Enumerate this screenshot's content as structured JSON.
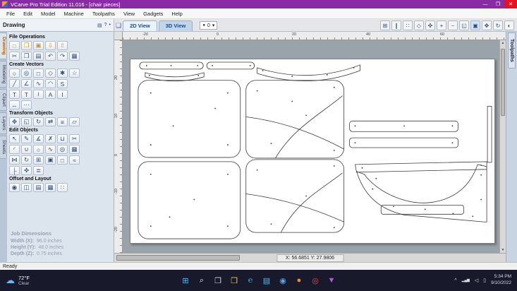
{
  "titlebar": {
    "title": "VCarve Pro Trial Edition 11.016 - [chair pieces]",
    "minimize": "—",
    "maximize": "❐",
    "close": "✕"
  },
  "menu": {
    "items": [
      {
        "label": "File"
      },
      {
        "label": "Edit"
      },
      {
        "label": "Model"
      },
      {
        "label": "Machine"
      },
      {
        "label": "Toolpaths"
      },
      {
        "label": "View"
      },
      {
        "label": "Gadgets"
      },
      {
        "label": "Help"
      }
    ]
  },
  "panel_header": {
    "title": "Drawing",
    "icons": [
      {
        "n": "panel-options-icon",
        "g": "▤"
      },
      {
        "n": "help-icon",
        "g": "?"
      },
      {
        "n": "pin-icon",
        "g": "•"
      }
    ]
  },
  "view_toolbar": {
    "window_icon": "❏",
    "tabs": [
      {
        "label": "2D View"
      },
      {
        "label": "3D View"
      }
    ],
    "layer": {
      "dot": "●",
      "value": "0",
      "caret": "▾"
    },
    "icons": [
      {
        "n": "toggle-grid-icon",
        "g": "⊞"
      },
      {
        "n": "toggle-guides-icon",
        "g": "∥"
      },
      {
        "n": "snap-grid-icon",
        "g": "∷"
      },
      {
        "n": "snap-geometry-icon",
        "g": "◇"
      },
      {
        "n": "snap-smart-icon",
        "g": "✜"
      },
      {
        "n": "zoom-in-icon",
        "g": "+"
      },
      {
        "n": "zoom-out-icon",
        "g": "−"
      },
      {
        "n": "zoom-window-icon",
        "g": "◱"
      },
      {
        "n": "zoom-extents-icon",
        "g": "▣",
        "bg": "#cfe4f8"
      },
      {
        "n": "pan-view-icon",
        "g": "✥"
      },
      {
        "n": "refresh-2d-icon",
        "g": "↻"
      },
      {
        "n": "shaded-view-icon",
        "g": "◐"
      }
    ]
  },
  "left_tabs": {
    "items": [
      {
        "label": "Drawing",
        "cls": "side-tab active"
      },
      {
        "label": "Modeling",
        "cls": "side-tab"
      },
      {
        "label": "Clipart",
        "cls": "side-tab"
      },
      {
        "label": "Layers",
        "cls": "side-tab"
      },
      {
        "label": "Sheets",
        "cls": "side-tab"
      }
    ]
  },
  "right_tabs": {
    "items": [
      {
        "label": "Toolpaths"
      }
    ]
  },
  "sections": [
    {
      "title": "File Operations",
      "rows": [
        {
          "icons": [
            {
              "n": "new-file-icon",
              "g": "□",
              "c": "#c09a2c"
            },
            {
              "n": "open-file-icon",
              "g": "❒",
              "c": "#c09a2c"
            },
            {
              "n": "save-file-icon",
              "g": "▣",
              "c": "#c09a2c"
            },
            {
              "n": "import-vectors-icon",
              "g": "⇩",
              "c": "#c09a2c"
            },
            {
              "n": "export-vectors-icon",
              "g": "⇧",
              "c": "#c09a2c"
            }
          ]
        },
        {
          "icons": [
            {
              "n": "cut-icon",
              "g": "✂"
            },
            {
              "n": "copy-icon",
              "g": "❐"
            },
            {
              "n": "paste-icon",
              "g": "▤"
            },
            {
              "n": "undo-icon",
              "g": "↶"
            },
            {
              "n": "redo-icon",
              "g": "↷"
            },
            {
              "n": "snapshot-icon",
              "g": "▦"
            }
          ]
        }
      ]
    },
    {
      "title": "Create Vectors",
      "rows": [
        {
          "icons": [
            {
              "n": "draw-circle-icon",
              "g": "○"
            },
            {
              "n": "draw-ellipse-icon",
              "g": "◎"
            },
            {
              "n": "draw-rectangle-icon",
              "g": "□"
            },
            {
              "n": "draw-polygon-icon",
              "g": "◇"
            },
            {
              "n": "draw-gear-icon",
              "g": "✱"
            },
            {
              "n": "draw-star-icon",
              "g": "☆"
            }
          ]
        },
        {
          "icons": [
            {
              "n": "draw-line-icon",
              "g": "╱"
            },
            {
              "n": "draw-polyline-icon",
              "g": "∠"
            },
            {
              "n": "draw-curve-icon",
              "g": "∿"
            },
            {
              "n": "draw-arc-icon",
              "g": "◠"
            },
            {
              "n": "smart-curve-icon",
              "g": "S"
            }
          ]
        },
        {
          "icons": [
            {
              "n": "draw-text-icon",
              "g": "T"
            },
            {
              "n": "text-block-icon",
              "g": "T"
            },
            {
              "n": "text-on-curve-icon",
              "g": "≀"
            },
            {
              "n": "convert-text-icon",
              "g": "A"
            },
            {
              "n": "text-select-icon",
              "g": "I"
            }
          ]
        },
        {
          "icons": [
            {
              "n": "dimension-icon",
              "g": "↔"
            },
            {
              "n": "more-tools-icon",
              "g": "⋯"
            }
          ]
        }
      ]
    },
    {
      "title": "Transform Objects",
      "rows": [
        {
          "icons": [
            {
              "n": "move-icon",
              "g": "✥"
            },
            {
              "n": "set-size-icon",
              "g": "◱"
            },
            {
              "n": "rotate-icon",
              "g": "↻"
            },
            {
              "n": "mirror-icon",
              "g": "⇄"
            },
            {
              "n": "align-icon",
              "g": "≡"
            },
            {
              "n": "distort-icon",
              "g": "▱"
            }
          ]
        }
      ]
    },
    {
      "title": "Edit Objects",
      "rows": [
        {
          "icons": [
            {
              "n": "select-icon",
              "g": "↖"
            },
            {
              "n": "node-edit-icon",
              "g": "✎"
            },
            {
              "n": "measure-icon",
              "g": "∡"
            },
            {
              "n": "erase-icon",
              "g": "✗"
            },
            {
              "n": "weld-vectors-icon",
              "g": "⊔"
            },
            {
              "n": "trim-vectors-icon",
              "g": "✂"
            }
          ]
        },
        {
          "icons": [
            {
              "n": "fillet-icon",
              "g": "◜"
            },
            {
              "n": "join-vectors-icon",
              "g": "∪"
            },
            {
              "n": "close-vector-icon",
              "g": "○"
            },
            {
              "n": "fit-curves-icon",
              "g": "∿"
            },
            {
              "n": "offset-vectors-icon",
              "g": "◎"
            },
            {
              "n": "array-copy-icon",
              "g": "▦"
            }
          ]
        },
        {
          "icons": [
            {
              "n": "mirror-copy-icon",
              "g": "⋈"
            },
            {
              "n": "rotate-copy-icon",
              "g": "↻"
            },
            {
              "n": "block-copy-icon",
              "g": "⊞"
            },
            {
              "n": "group-icon",
              "g": "▣"
            },
            {
              "n": "ungroup-icon",
              "g": "□"
            },
            {
              "n": "smooth-icon",
              "g": "≈"
            }
          ]
        },
        {
          "icons": [
            {
              "n": "extend-icon",
              "g": "├"
            },
            {
              "n": "snap-toggle-icon",
              "g": "✜"
            },
            {
              "n": "z-order-icon",
              "g": "≣"
            }
          ]
        }
      ]
    },
    {
      "title": "Offset and Layout",
      "rows": [
        {
          "icons": [
            {
              "n": "offset-icon",
              "g": "◉"
            },
            {
              "n": "inset-icon",
              "g": "◫"
            },
            {
              "n": "nesting-icon",
              "g": "▤"
            },
            {
              "n": "layout-icon",
              "g": "▦"
            },
            {
              "n": "nest-parts-icon",
              "g": "∷"
            }
          ]
        }
      ]
    }
  ],
  "job_dimensions": {
    "title": "Job Dimensions",
    "rows": [
      {
        "label": "Width  (X):",
        "value": "96.0 inches"
      },
      {
        "label": "Height (Y):",
        "value": "48.0 inches"
      },
      {
        "label": "Depth  (Z):",
        "value": "0.75 inches"
      }
    ]
  },
  "rulers": {
    "top": [
      {
        "v": "-20"
      },
      {
        "v": "0"
      },
      {
        "v": "20"
      },
      {
        "v": "40"
      },
      {
        "v": "60"
      }
    ],
    "left": [
      {
        "v": "20"
      },
      {
        "v": "10"
      },
      {
        "v": "0"
      },
      {
        "v": "-10"
      },
      {
        "v": "-20"
      }
    ]
  },
  "canvas": {
    "coords": "X: 56.6851 Y: 27.9806"
  },
  "statusbar": {
    "ready": "Ready"
  },
  "taskbar": {
    "weather": {
      "temp": "72°F",
      "desc": "Clear"
    },
    "apps": [
      {
        "n": "start-button",
        "g": "⊞",
        "c": "#4cc2ff"
      },
      {
        "n": "search-icon",
        "g": "⌕",
        "c": "#e8e8e8"
      },
      {
        "n": "task-view-icon",
        "g": "❐",
        "c": "#cfd4e2"
      },
      {
        "n": "file-explorer-icon",
        "g": "❒",
        "c": "#f0c463"
      },
      {
        "n": "edge-icon",
        "g": "℮",
        "c": "#45c0e8"
      },
      {
        "n": "store-icon",
        "g": "▤",
        "c": "#58b8f0"
      },
      {
        "n": "chrome-icon",
        "g": "◉",
        "c": "#5aa2e8"
      },
      {
        "n": "firefox-icon",
        "g": "●",
        "c": "#f28a2a"
      },
      {
        "n": "opera-icon",
        "g": "◎",
        "c": "#e84a4a"
      },
      {
        "n": "vcarve-icon",
        "g": "▼",
        "c": "#b45ae0"
      }
    ],
    "tray": {
      "chevron": "^",
      "net": "▂▄▆",
      "vol": "◁",
      "bat": "▯",
      "time": "5:34 PM",
      "date": "9/10/2022"
    }
  }
}
